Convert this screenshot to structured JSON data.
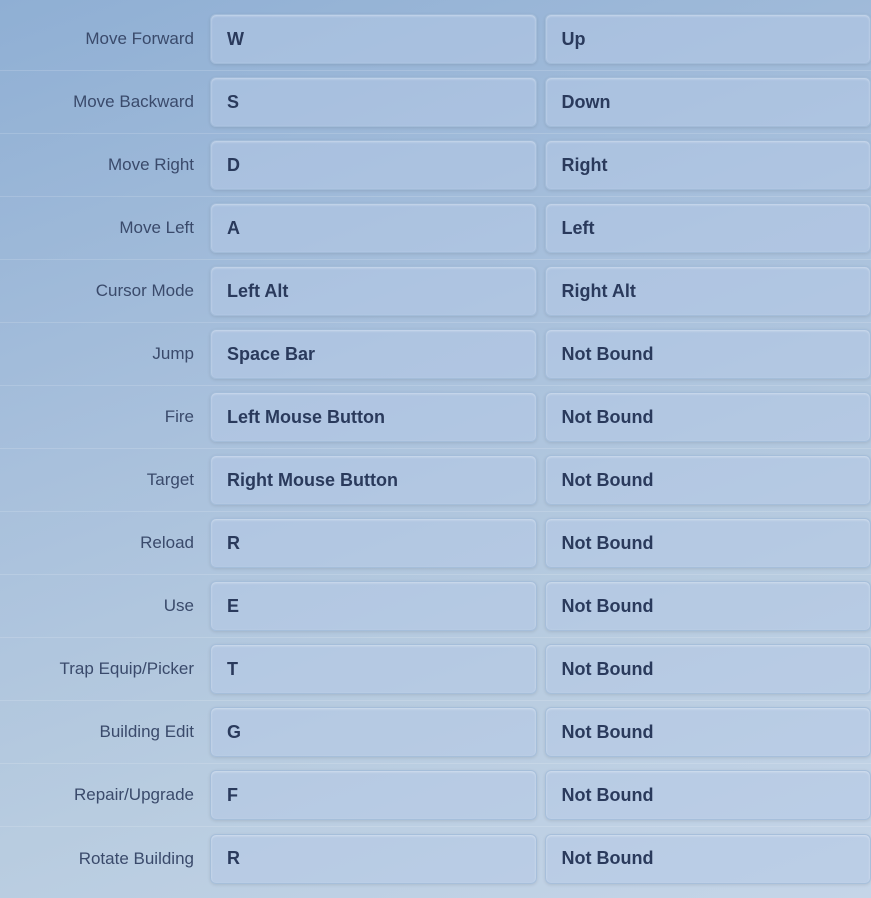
{
  "bindings": [
    {
      "action": "Move Forward",
      "primary": "W",
      "secondary": "Up"
    },
    {
      "action": "Move Backward",
      "primary": "S",
      "secondary": "Down"
    },
    {
      "action": "Move Right",
      "primary": "D",
      "secondary": "Right"
    },
    {
      "action": "Move Left",
      "primary": "A",
      "secondary": "Left"
    },
    {
      "action": "Cursor Mode",
      "primary": "Left Alt",
      "secondary": "Right Alt"
    },
    {
      "action": "Jump",
      "primary": "Space Bar",
      "secondary": "Not Bound"
    },
    {
      "action": "Fire",
      "primary": "Left Mouse Button",
      "secondary": "Not Bound"
    },
    {
      "action": "Target",
      "primary": "Right Mouse Button",
      "secondary": "Not Bound"
    },
    {
      "action": "Reload",
      "primary": "R",
      "secondary": "Not Bound"
    },
    {
      "action": "Use",
      "primary": "E",
      "secondary": "Not Bound"
    },
    {
      "action": "Trap Equip/Picker",
      "primary": "T",
      "secondary": "Not Bound"
    },
    {
      "action": "Building Edit",
      "primary": "G",
      "secondary": "Not Bound"
    },
    {
      "action": "Repair/Upgrade",
      "primary": "F",
      "secondary": "Not Bound"
    },
    {
      "action": "Rotate Building",
      "primary": "R",
      "secondary": "Not Bound"
    }
  ]
}
